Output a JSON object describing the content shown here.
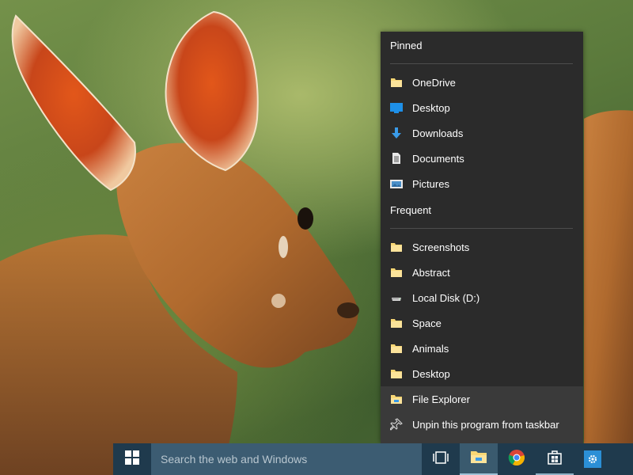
{
  "jumplist": {
    "pinned_heading": "Pinned",
    "pinned": [
      {
        "label": "OneDrive",
        "icon": "folder-icon"
      },
      {
        "label": "Desktop",
        "icon": "desktop-icon"
      },
      {
        "label": "Downloads",
        "icon": "download-arrow-icon"
      },
      {
        "label": "Documents",
        "icon": "document-icon"
      },
      {
        "label": "Pictures",
        "icon": "pictures-icon"
      }
    ],
    "frequent_heading": "Frequent",
    "frequent": [
      {
        "label": "Screenshots",
        "icon": "folder-icon"
      },
      {
        "label": "Abstract",
        "icon": "folder-icon"
      },
      {
        "label": "Local Disk (D:)",
        "icon": "drive-icon"
      },
      {
        "label": "Space",
        "icon": "folder-icon"
      },
      {
        "label": "Animals",
        "icon": "folder-icon"
      },
      {
        "label": "Desktop",
        "icon": "folder-icon"
      }
    ],
    "actions": [
      {
        "label": "File Explorer",
        "icon": "file-explorer-icon"
      },
      {
        "label": "Unpin this program from taskbar",
        "icon": "unpin-icon"
      }
    ]
  },
  "taskbar": {
    "search_placeholder": "Search the web and Windows",
    "buttons": [
      {
        "name": "task-view",
        "icon": "task-view-icon"
      },
      {
        "name": "file-explorer",
        "icon": "file-explorer-icon",
        "state": "active"
      },
      {
        "name": "chrome",
        "icon": "chrome-icon"
      },
      {
        "name": "store",
        "icon": "store-icon"
      },
      {
        "name": "settings",
        "icon": "gear-icon"
      }
    ]
  },
  "colors": {
    "jumplist_bg": "#2b2b2b",
    "jumplist_action_bg": "#3a3a3a",
    "taskbar_bg": "#1f3a4d",
    "search_bg": "#3c5c72",
    "folder_yellow": "#f8d775",
    "accent_blue": "#1e90e8"
  }
}
